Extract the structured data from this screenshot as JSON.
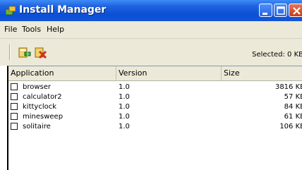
{
  "window": {
    "title": "Install Manager",
    "title_color": "#ffffff",
    "accent": "#0a4fd6"
  },
  "menu": {
    "items": [
      "File",
      "Tools",
      "Help"
    ]
  },
  "toolbar": {
    "buttons": [
      "install-icon",
      "remove-icon"
    ],
    "selected_text": "Selected: 0 KB"
  },
  "list": {
    "columns": [
      "Application",
      "Version",
      "Size"
    ],
    "rows": [
      {
        "name": "browser",
        "version": "1.0",
        "size": "3816 KB",
        "checked": false
      },
      {
        "name": "calculator2",
        "version": "1.0",
        "size": "57 KB",
        "checked": false
      },
      {
        "name": "kittyclock",
        "version": "1.0",
        "size": "84 KB",
        "checked": false
      },
      {
        "name": "minesweep",
        "version": "1.0",
        "size": "61 KB",
        "checked": false
      },
      {
        "name": "solitaire",
        "version": "1.0",
        "size": "106 KB",
        "checked": false
      }
    ]
  }
}
